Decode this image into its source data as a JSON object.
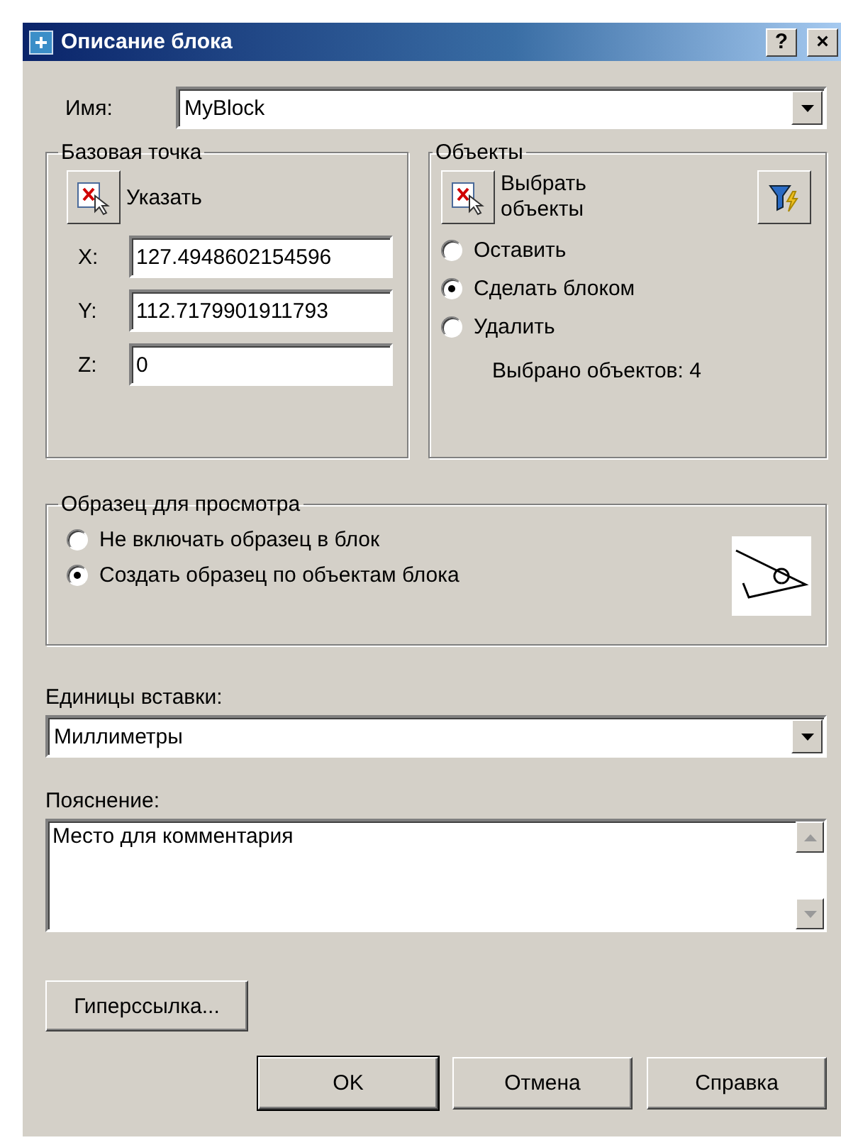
{
  "window": {
    "title": "Описание блока",
    "help": "?",
    "close": "×"
  },
  "name": {
    "label": "Имя:",
    "value": "MyBlock"
  },
  "base_point": {
    "title": "Базовая точка",
    "pick_button": "Указать",
    "coords": [
      {
        "label": "X:",
        "value": "127.4948602154596"
      },
      {
        "label": "Y:",
        "value": "112.7179901911793"
      },
      {
        "label": "Z:",
        "value": "0"
      }
    ]
  },
  "objects": {
    "title": "Объекты",
    "select_button": "Выбрать объекты",
    "options": [
      {
        "label": "Оставить",
        "selected": false
      },
      {
        "label": "Сделать блоком",
        "selected": true
      },
      {
        "label": "Удалить",
        "selected": false
      }
    ],
    "count": "Выбрано объектов: 4"
  },
  "preview": {
    "title": "Образец для просмотра",
    "options": [
      {
        "label": "Не включать образец в блок",
        "selected": false
      },
      {
        "label": "Создать образец по объектам блока",
        "selected": true
      }
    ]
  },
  "units": {
    "label": "Единицы вставки:",
    "value": "Миллиметры"
  },
  "description": {
    "label": "Пояснение:",
    "value": "Место для комментария"
  },
  "hyperlink_button": "Гиперссылка...",
  "buttons": [
    {
      "label": "OK",
      "kind": "default"
    },
    {
      "label": "Отмена",
      "kind": "normal"
    },
    {
      "label": "Справка",
      "kind": "normal"
    }
  ]
}
